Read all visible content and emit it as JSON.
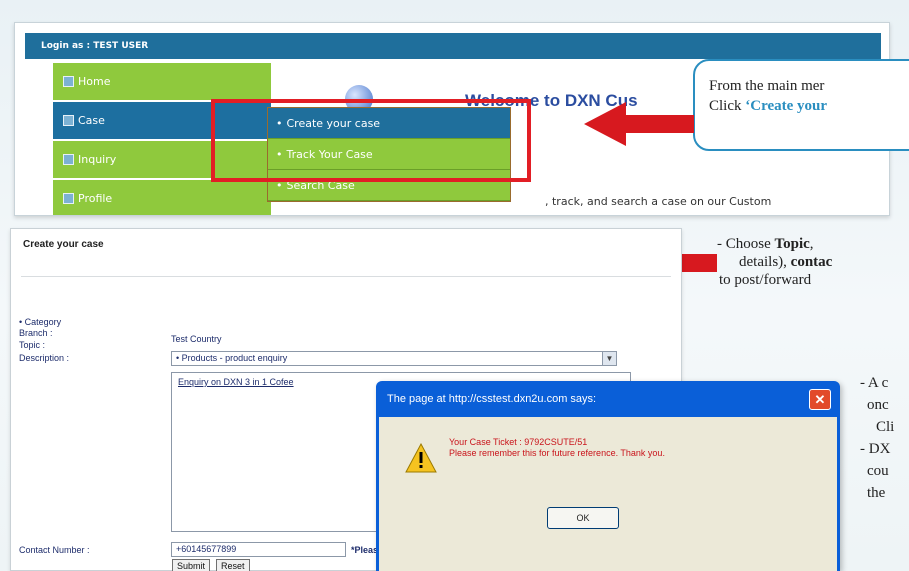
{
  "top_shot": {
    "login_text": "Login as : TEST USER",
    "nav_items": [
      {
        "label": "Home"
      },
      {
        "label": "Case"
      },
      {
        "label": "Inquiry"
      },
      {
        "label": "Profile"
      }
    ],
    "submenu_items": [
      {
        "label": "Create your case"
      },
      {
        "label": "Track Your Case"
      },
      {
        "label": "Search Case"
      }
    ],
    "welcome_text": "Welcome to DXN Cus",
    "desc_text": ", track, and search a case on our Custom",
    "colors": {
      "nav_green": "#8fc93d",
      "nav_blue": "#1d6fa0",
      "highlight_red": "#e21e25"
    }
  },
  "callout": {
    "line1": "From the main mer",
    "line2_prefix": "Click ",
    "line2_highlight": "‘Create your"
  },
  "case_form": {
    "title": "Create your case",
    "labels": {
      "category": "• Category",
      "branch": "Branch :",
      "topic": "Topic :",
      "description": "Description :",
      "contact": "Contact Number :"
    },
    "branch_value": "Test Country",
    "topic_value": "• Products - product enquiry",
    "description_value": "Enquiry on DXN 3 in 1 Cofee",
    "contact_value": "+60145677899",
    "contact_hint": "*Please",
    "submit_label": "Submit",
    "reset_label": "Reset"
  },
  "dialog": {
    "title": "The page at http://csstest.dxn2u.com says:",
    "line1": "Your Case Ticket : 9792CSUTE/51",
    "line2": "Please remember this for future reference. Thank you.",
    "ok_label": "OK"
  },
  "instructions": {
    "a_line1_prefix": "- Choose ",
    "a_line1_bold": "Topic",
    "a_line1_rest": ",",
    "a_line2_prefix": "details), ",
    "a_line2_bold": "contac",
    "a_line3": "to post/forward",
    "b_line1": "- A c",
    "b_line2": "onc",
    "b_line3": "Cli",
    "b_line4": "- DX",
    "b_line5": "cou",
    "b_line6": "the"
  }
}
